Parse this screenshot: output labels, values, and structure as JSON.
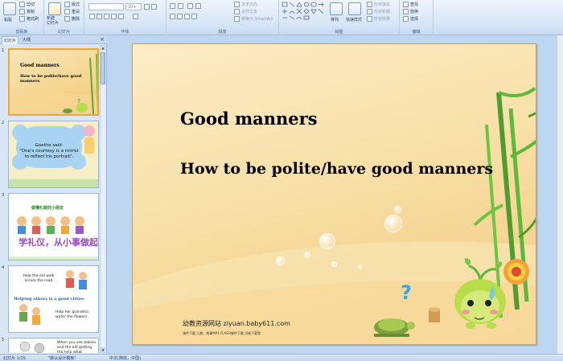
{
  "ribbon": {
    "clipboard": {
      "paste": "粘贴",
      "cut": "剪切",
      "copy": "复制",
      "format_painter": "格式刷",
      "group": "剪贴板"
    },
    "slides": {
      "new_slide": "新建\n幻灯片",
      "layout": "版式",
      "reset": "重设",
      "delete": "删除",
      "group": "幻灯片"
    },
    "font": {
      "size": "20+",
      "group": "字体"
    },
    "paragraph": {
      "text_direction": "文字方向",
      "align_text": "对齐文本",
      "smartart": "转换为 SmartArt",
      "group": "段落"
    },
    "drawing": {
      "arrange": "排列",
      "quick_styles": "快速样式",
      "fill": "形状填充",
      "outline": "形状轮廓",
      "effects": "形状效果",
      "group": "绘图"
    },
    "editing": {
      "find": "查找",
      "replace": "替换",
      "select": "选择",
      "group": "编辑"
    }
  },
  "left_panel": {
    "tabs": [
      "幻灯片",
      "大纲"
    ],
    "close": "×",
    "slides": [
      {
        "num": "1",
        "line1": "Good manners",
        "line2": "How to be polite/have good manners"
      },
      {
        "num": "2",
        "text": "Goethe said:\n\"One's courtesy is a mirror to reflect his portrait\"."
      },
      {
        "num": "3",
        "title": "做懂礼貌的小朋友",
        "big": "学礼仪，从小事做起"
      },
      {
        "num": "4",
        "a": "Help the old walk across the road",
        "b": "Helping others is a good virtue.",
        "c": "Help her grandma water the flowers"
      },
      {
        "num": "5",
        "a": "When you see babies and the old getting the help what"
      }
    ]
  },
  "slide": {
    "title": "Good manners",
    "subtitle": "How to be polite/have good manners",
    "site": "幼教资源网站  ziyuan.baby611.com",
    "sub": "课件下载    儿歌、故事MP3    FLASH课件下载    试卷下载等",
    "question_mark": "?"
  },
  "status": {
    "slide_count": "幻灯片 1/15",
    "theme": "\"默认设计模板\"",
    "language": "中文(简体，中国)"
  }
}
